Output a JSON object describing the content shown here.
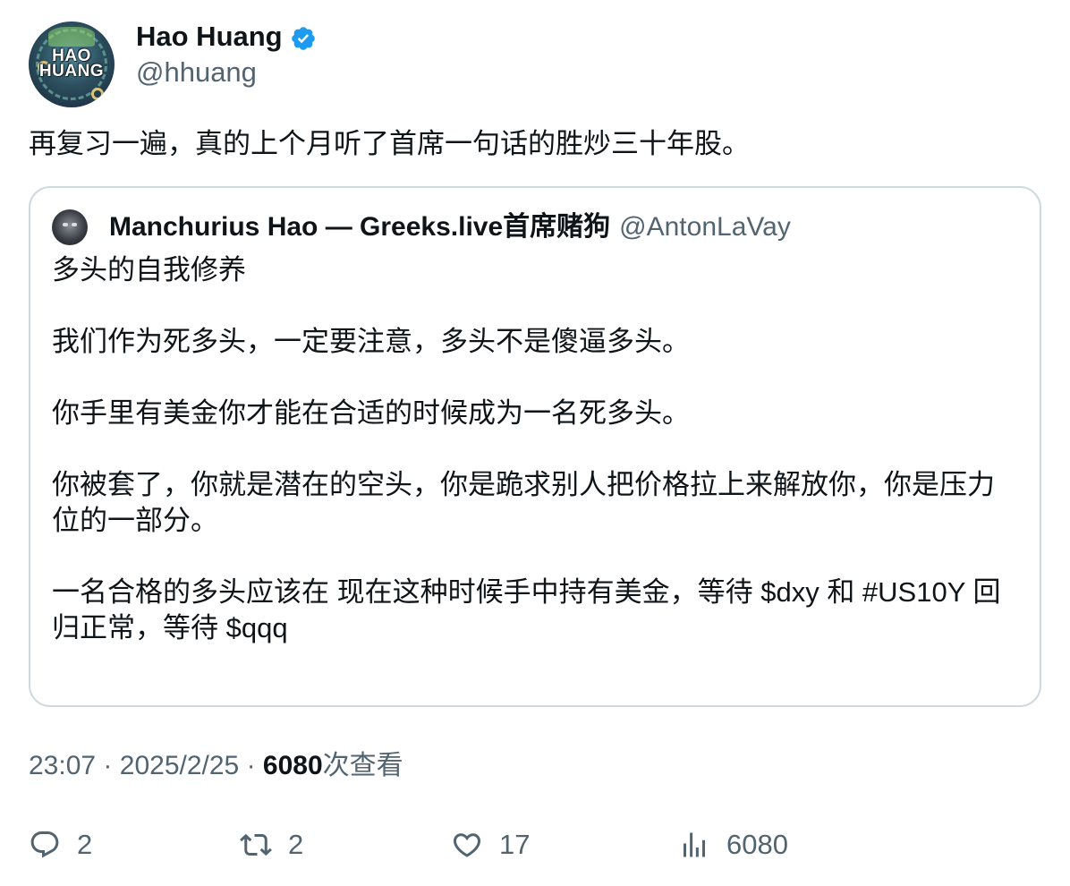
{
  "author": {
    "name": "Hao Huang",
    "handle": "@hhuang",
    "avatar_text_line1": "HAO",
    "avatar_text_line2": "HUANG"
  },
  "tweet_text": "再复习一遍，真的上个月听了首席一句话的胜炒三十年股。",
  "quote": {
    "author_name": "Manchurius Hao — Greeks.live首席赌狗",
    "handle": "@AntonLaVay",
    "paragraphs": [
      "多头的自我修养",
      "我们作为死多头，一定要注意，多头不是傻逼多头。",
      "你手里有美金你才能在合适的时候成为一名死多头。",
      "你被套了，你就是潜在的空头，你是跪求别人把价格拉上来解放你，你是压力位的一部分。",
      "一名合格的多头应该在 现在这种时候手中持有美金，等待 $dxy 和 #US10Y 回归正常，等待 $qqq"
    ]
  },
  "meta": {
    "time": "23:07",
    "separator": "·",
    "date": "2025/2/25",
    "views_count": "6080",
    "views_label": "次查看"
  },
  "actions": {
    "reply_count": "2",
    "retweet_count": "2",
    "like_count": "17",
    "views_count": "6080"
  },
  "colors": {
    "text_primary": "#0f1419",
    "text_secondary": "#536471",
    "border": "#cfd9de",
    "verified": "#1d9bf0"
  },
  "icons": {
    "verified": "verified-badge-icon",
    "reply": "reply-icon",
    "retweet": "retweet-icon",
    "like": "heart-icon",
    "views": "views-bar-chart-icon"
  }
}
